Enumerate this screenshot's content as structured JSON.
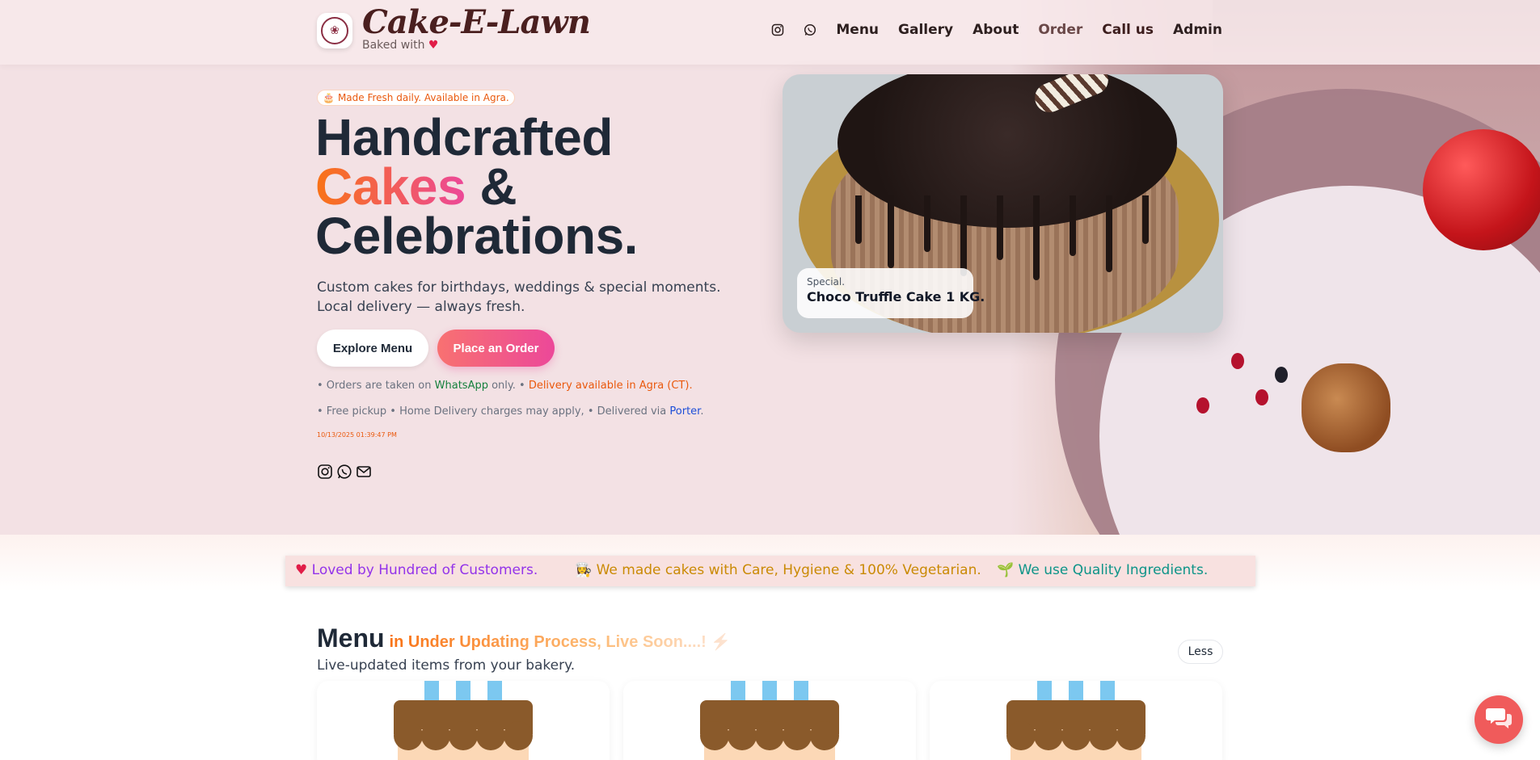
{
  "header": {
    "brand": "Cake-E-Lawn",
    "tagline": "Baked with",
    "nav": {
      "menu": "Menu",
      "gallery": "Gallery",
      "about": "About",
      "order": "Order",
      "call_us": "Call us",
      "admin": "Admin"
    }
  },
  "hero": {
    "pill": "Made Fresh daily. Available in Agra.",
    "headline_line1": "Handcrafted",
    "headline_highlight": "Cakes",
    "headline_amp": " &",
    "headline_line3": "Celebrations.",
    "lead": "Custom cakes for birthdays, weddings & special moments. Local delivery — always fresh.",
    "explore_button": "Explore Menu",
    "order_button": "Place an Order",
    "note1_prefix": "• Orders are taken on ",
    "note1_whatsapp": "WhatsApp",
    "note1_mid": " only. • ",
    "note1_delivery": "Delivery available in Agra (CT).",
    "note2_prefix": "• Free pickup • Home Delivery charges may apply, • Delivered via ",
    "note2_porter": "Porter",
    "note2_suffix": ".",
    "timestamp": "10/13/2025 01:39:47 PM"
  },
  "feature": {
    "kicker": "Special.",
    "title": "Choco Truffle Cake 1 KG."
  },
  "strip": {
    "item1": "Loved by Hundred of Customers.",
    "item2": "We made cakes with Care, Hygiene & 100% Vegetarian.",
    "item3": "We use Quality Ingredients."
  },
  "menu": {
    "title": "Menu",
    "status": "in Under Updating Process, Live Soon....! ⚡",
    "subtitle": "Live-updated items from your bakery.",
    "toggle": "Less"
  },
  "colors": {
    "accent_orange": "#f97316",
    "accent_pink": "#ec4899",
    "hero_bg": "#f3e1e4"
  }
}
